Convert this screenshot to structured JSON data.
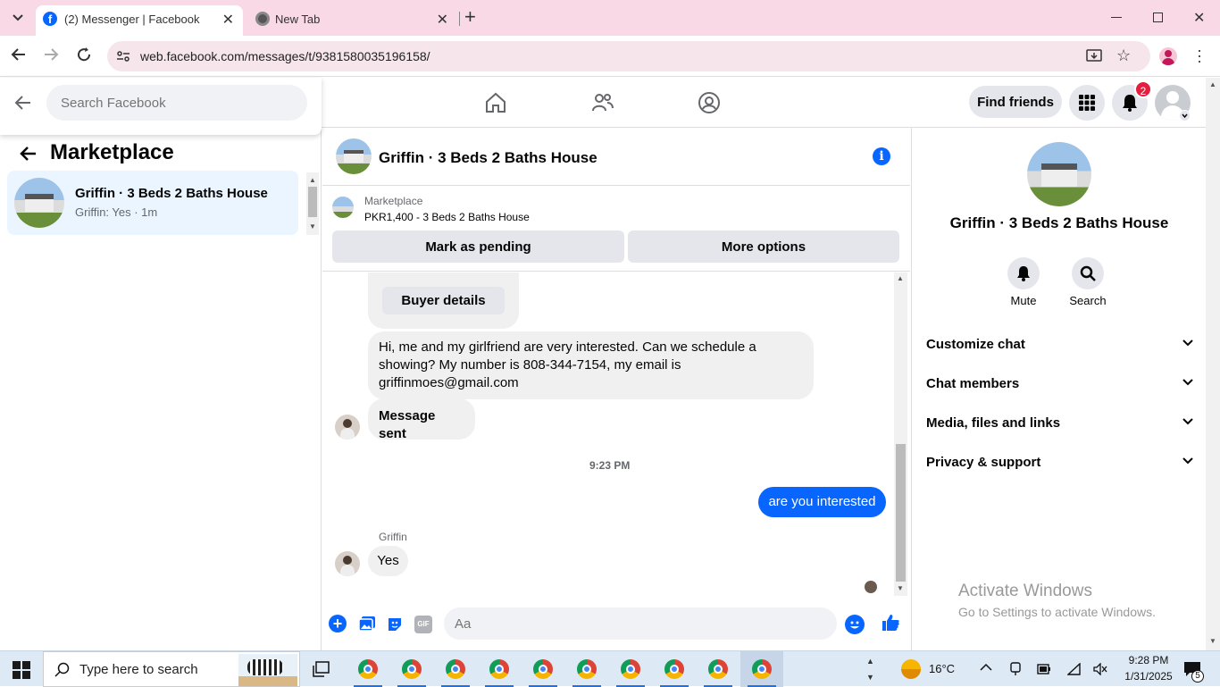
{
  "browser": {
    "tabs": [
      {
        "label": "(2) Messenger | Facebook"
      },
      {
        "label": "New Tab"
      }
    ],
    "url": "web.facebook.com/messages/t/9381580035196158/"
  },
  "fb_header": {
    "search_placeholder": "Search Facebook",
    "find_friends": "Find friends",
    "notification_count": "2"
  },
  "left_panel": {
    "title": "Marketplace",
    "conversations": [
      {
        "name": "Griffin · 3 Beds 2 Baths House",
        "preview": "Griffin: Yes · 1m"
      }
    ]
  },
  "chat": {
    "title": "Griffin · 3 Beds 2 Baths House",
    "listing": {
      "source": "Marketplace",
      "price_title": "PKR1,400 - 3 Beds 2 Baths House",
      "mark_pending": "Mark as pending",
      "more_options": "More options"
    },
    "messages": {
      "buyer_details": "Buyer details",
      "m1": "Hi, me and my girlfriend are very interested. Can we schedule a showing? My number is 808-344-7154, my email is griffinmoes@gmail.com",
      "m2": "Message sent",
      "timestamp": "9:23 PM",
      "m3": "are you interested",
      "sender": "Griffin",
      "m4": "Yes"
    },
    "composer_placeholder": "Aa"
  },
  "right_panel": {
    "name": "Griffin · 3 Beds 2 Baths House",
    "mute": "Mute",
    "search": "Search",
    "sections": [
      "Customize chat",
      "Chat members",
      "Media, files and links",
      "Privacy & support"
    ]
  },
  "watermark": {
    "line1": "Activate Windows",
    "line2": "Go to Settings to activate Windows."
  },
  "taskbar": {
    "search_placeholder": "Type here to search",
    "weather": "16°C",
    "time": "9:28 PM",
    "date": "1/31/2025",
    "notif_count": "5"
  },
  "colors": {
    "accent": "#0866ff",
    "tabbar": "#f8d9e5",
    "badge": "#e41e3f"
  }
}
